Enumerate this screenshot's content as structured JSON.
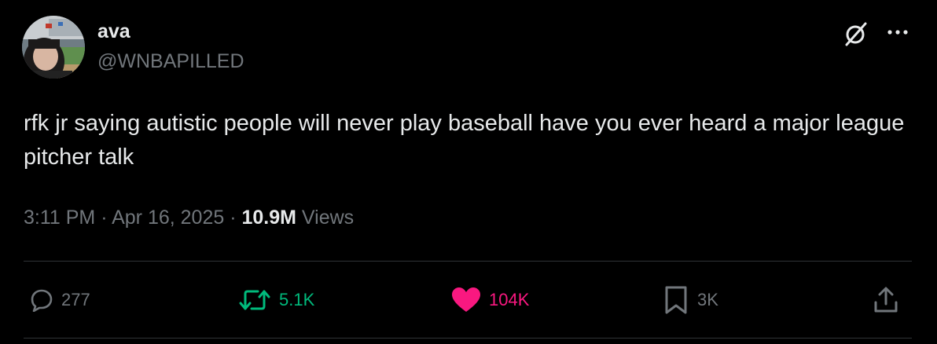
{
  "author": {
    "name": "ava",
    "handle": "@WNBAPILLED"
  },
  "tweet": {
    "text": "rfk jr saying autistic people will never play baseball have you ever heard a major league pitcher talk"
  },
  "meta": {
    "time": "3:11 PM",
    "separator": " · ",
    "date": "Apr 16, 2025",
    "views_count": "10.9M",
    "views_label": "Views"
  },
  "actions": {
    "replies": "277",
    "reposts": "5.1K",
    "likes": "104K",
    "bookmarks": "3K"
  },
  "icons": {
    "header_left_icon": "grok-slash-icon",
    "header_right_icon": "more-icon",
    "reply": "reply-icon",
    "repost": "repost-icon",
    "like": "like-icon",
    "bookmark": "bookmark-icon",
    "share": "share-icon"
  },
  "colors": {
    "background": "#000000",
    "text": "#e7e9ea",
    "secondary": "#71767b",
    "repost_active": "#00ba7c",
    "like_active": "#f91880",
    "divider": "#2f3336"
  }
}
